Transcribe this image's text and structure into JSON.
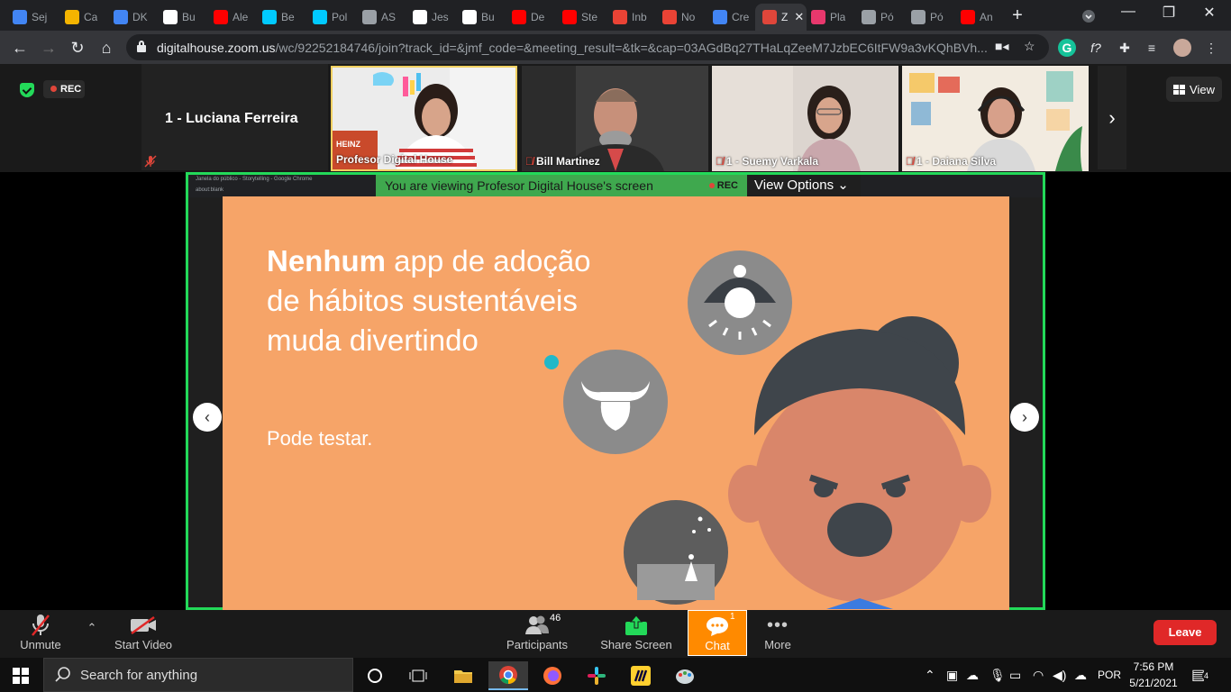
{
  "browser": {
    "tabs": [
      {
        "label": "Sej",
        "icon": "tab-icon-generic",
        "color": "#4285f4"
      },
      {
        "label": "Ca",
        "icon": "tab-icon-generic",
        "color": "#f4b400"
      },
      {
        "label": "DK",
        "icon": "docs-icon",
        "color": "#4285f4"
      },
      {
        "label": "Bu",
        "icon": "amazon-icon",
        "color": "#ffffff"
      },
      {
        "label": "Ale",
        "icon": "youtube-icon",
        "color": "#ff0000"
      },
      {
        "label": "Be",
        "icon": "alexa-icon",
        "color": "#00caff"
      },
      {
        "label": "Pol",
        "icon": "alexa-icon",
        "color": "#00caff"
      },
      {
        "label": "AS",
        "icon": "globe-icon",
        "color": "#9aa0a6"
      },
      {
        "label": "Jes",
        "icon": "medium-icon",
        "color": "#ffffff"
      },
      {
        "label": "Bu",
        "icon": "amazon-icon",
        "color": "#ffffff"
      },
      {
        "label": "De",
        "icon": "youtube-icon",
        "color": "#ff0000"
      },
      {
        "label": "Ste",
        "icon": "youtube-icon",
        "color": "#ff0000"
      },
      {
        "label": "Inb",
        "icon": "gmail-icon",
        "color": "#ea4335"
      },
      {
        "label": "No",
        "icon": "gmail-icon",
        "color": "#ea4335"
      },
      {
        "label": "Cre",
        "icon": "chrome-icon",
        "color": "#4285f4"
      },
      {
        "label": "Z",
        "icon": "zoom-record-icon",
        "color": "#e0463a"
      },
      {
        "label": "Pla",
        "icon": "dh-icon",
        "color": "#e8386d"
      },
      {
        "label": "Pó",
        "icon": "globe-icon",
        "color": "#9aa0a6"
      },
      {
        "label": "Pó",
        "icon": "globe-icon",
        "color": "#9aa0a6"
      },
      {
        "label": "An",
        "icon": "youtube-icon",
        "color": "#ff0000"
      }
    ],
    "url_host": "digitalhouse.zoom.us",
    "url_path": "/wc/92252184746/join?track_id=&jmf_code=&meeting_result=&tk=&cap=03AGdBq27THaLqZeeM7JzbEC6ItFW9a3vKQhBVh..."
  },
  "zoom": {
    "rec_label": "REC",
    "name_only_participant": "1 - Luciana Ferreira",
    "participants": [
      {
        "name": "Profesor Digital House",
        "muted": false
      },
      {
        "name": "Bill Martinez",
        "muted": true
      },
      {
        "name": "1 - Suemy Varkala",
        "muted": true
      },
      {
        "name": "1 - Daiana Silva",
        "muted": true
      }
    ],
    "view_label": "View",
    "viewing_text": "You are viewing Profesor Digital House's screen",
    "viewing_rec": "REC",
    "view_options": "View Options",
    "shared_window_title": "Janela do público - Storytelling - Google Chrome",
    "shared_url": "about:blank",
    "slide": {
      "headline_bold": "Nenhum",
      "headline_rest": " app de adoção de hábitos sustentáveis muda divertindo",
      "subtext": "Pode testar."
    },
    "controls": {
      "unmute": "Unmute",
      "start_video": "Start Video",
      "participants": "Participants",
      "participants_count": "46",
      "share_screen": "Share Screen",
      "chat": "Chat",
      "chat_badge": "1",
      "more": "More",
      "leave": "Leave"
    },
    "colors": {
      "accent_green": "#23d959",
      "leave_red": "#e02828",
      "chat_orange": "#ff8a00",
      "slide_bg": "#f6a468"
    }
  },
  "taskbar": {
    "search_placeholder": "Search for anything",
    "language": "POR",
    "time": "7:56 PM",
    "date": "5/21/2021",
    "notifications": "4"
  }
}
